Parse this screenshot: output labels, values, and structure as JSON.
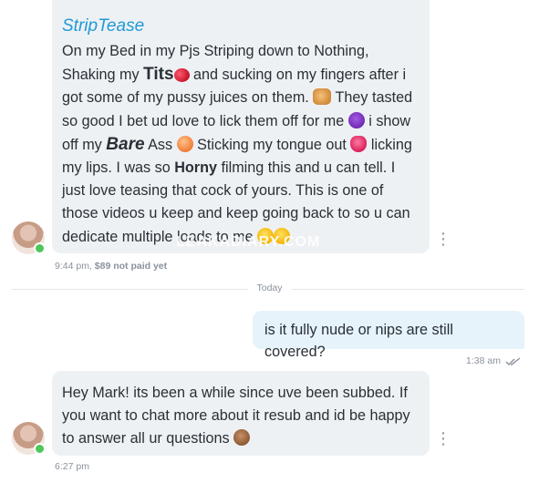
{
  "messages": [
    {
      "direction": "incoming",
      "title": "StripTease",
      "segments": [
        {
          "t": "On my Bed in my Pjs Striping down to Nothing, Shaking my "
        },
        {
          "t": "Tits",
          "style": "big-bold"
        },
        {
          "emoji": "cherries"
        },
        {
          "t": " and sucking on my fingers after i got some of my pussy juices on them. "
        },
        {
          "emoji": "cat-face"
        },
        {
          "t": " They tasted so good I bet ud love to lick them off for me "
        },
        {
          "emoji": "smiling-devil"
        },
        {
          "t": " i show off my "
        },
        {
          "t": "Bare",
          "style": "bold-italic"
        },
        {
          "t": " Ass "
        },
        {
          "emoji": "peach"
        },
        {
          "t": " Sticking my tongue out "
        },
        {
          "emoji": "tongue"
        },
        {
          "t": " licking my lips. I was so "
        },
        {
          "t": "Horny",
          "style": "bold"
        },
        {
          "t": " filming this and u can tell. I just love teasing that cock of yours. This is one of those videos u keep and keep going back to so u can dedicate multiple loads to me "
        },
        {
          "emoji": "drooling-face"
        },
        {
          "emoji": "relieved-face"
        }
      ],
      "time": "9:44 pm,",
      "price": "$89 not paid yet",
      "avatar": "avatar",
      "online": true
    },
    {
      "direction": "outgoing",
      "text": "is it fully nude or nips are still covered?",
      "time": "1:38 am",
      "status_icon": "double-check-icon"
    },
    {
      "direction": "incoming",
      "text": "Hey Mark! its been a while since uve been subbed. If you want to chat more about it resub and id be happy to answer all ur questions",
      "emoji": "see-no-evil-monkey",
      "time": "6:27 pm",
      "avatar": "avatar",
      "online": true
    }
  ],
  "divider": {
    "label": "Today"
  },
  "watermark": {
    "text": "LEAKADIARY.COM"
  },
  "colors": {
    "incoming_bubble": "#eef1f4",
    "outgoing_bubble": "#e6f3fb",
    "accent": "#1f9ad6",
    "online": "#4ec75a",
    "muted": "#8a929c"
  }
}
